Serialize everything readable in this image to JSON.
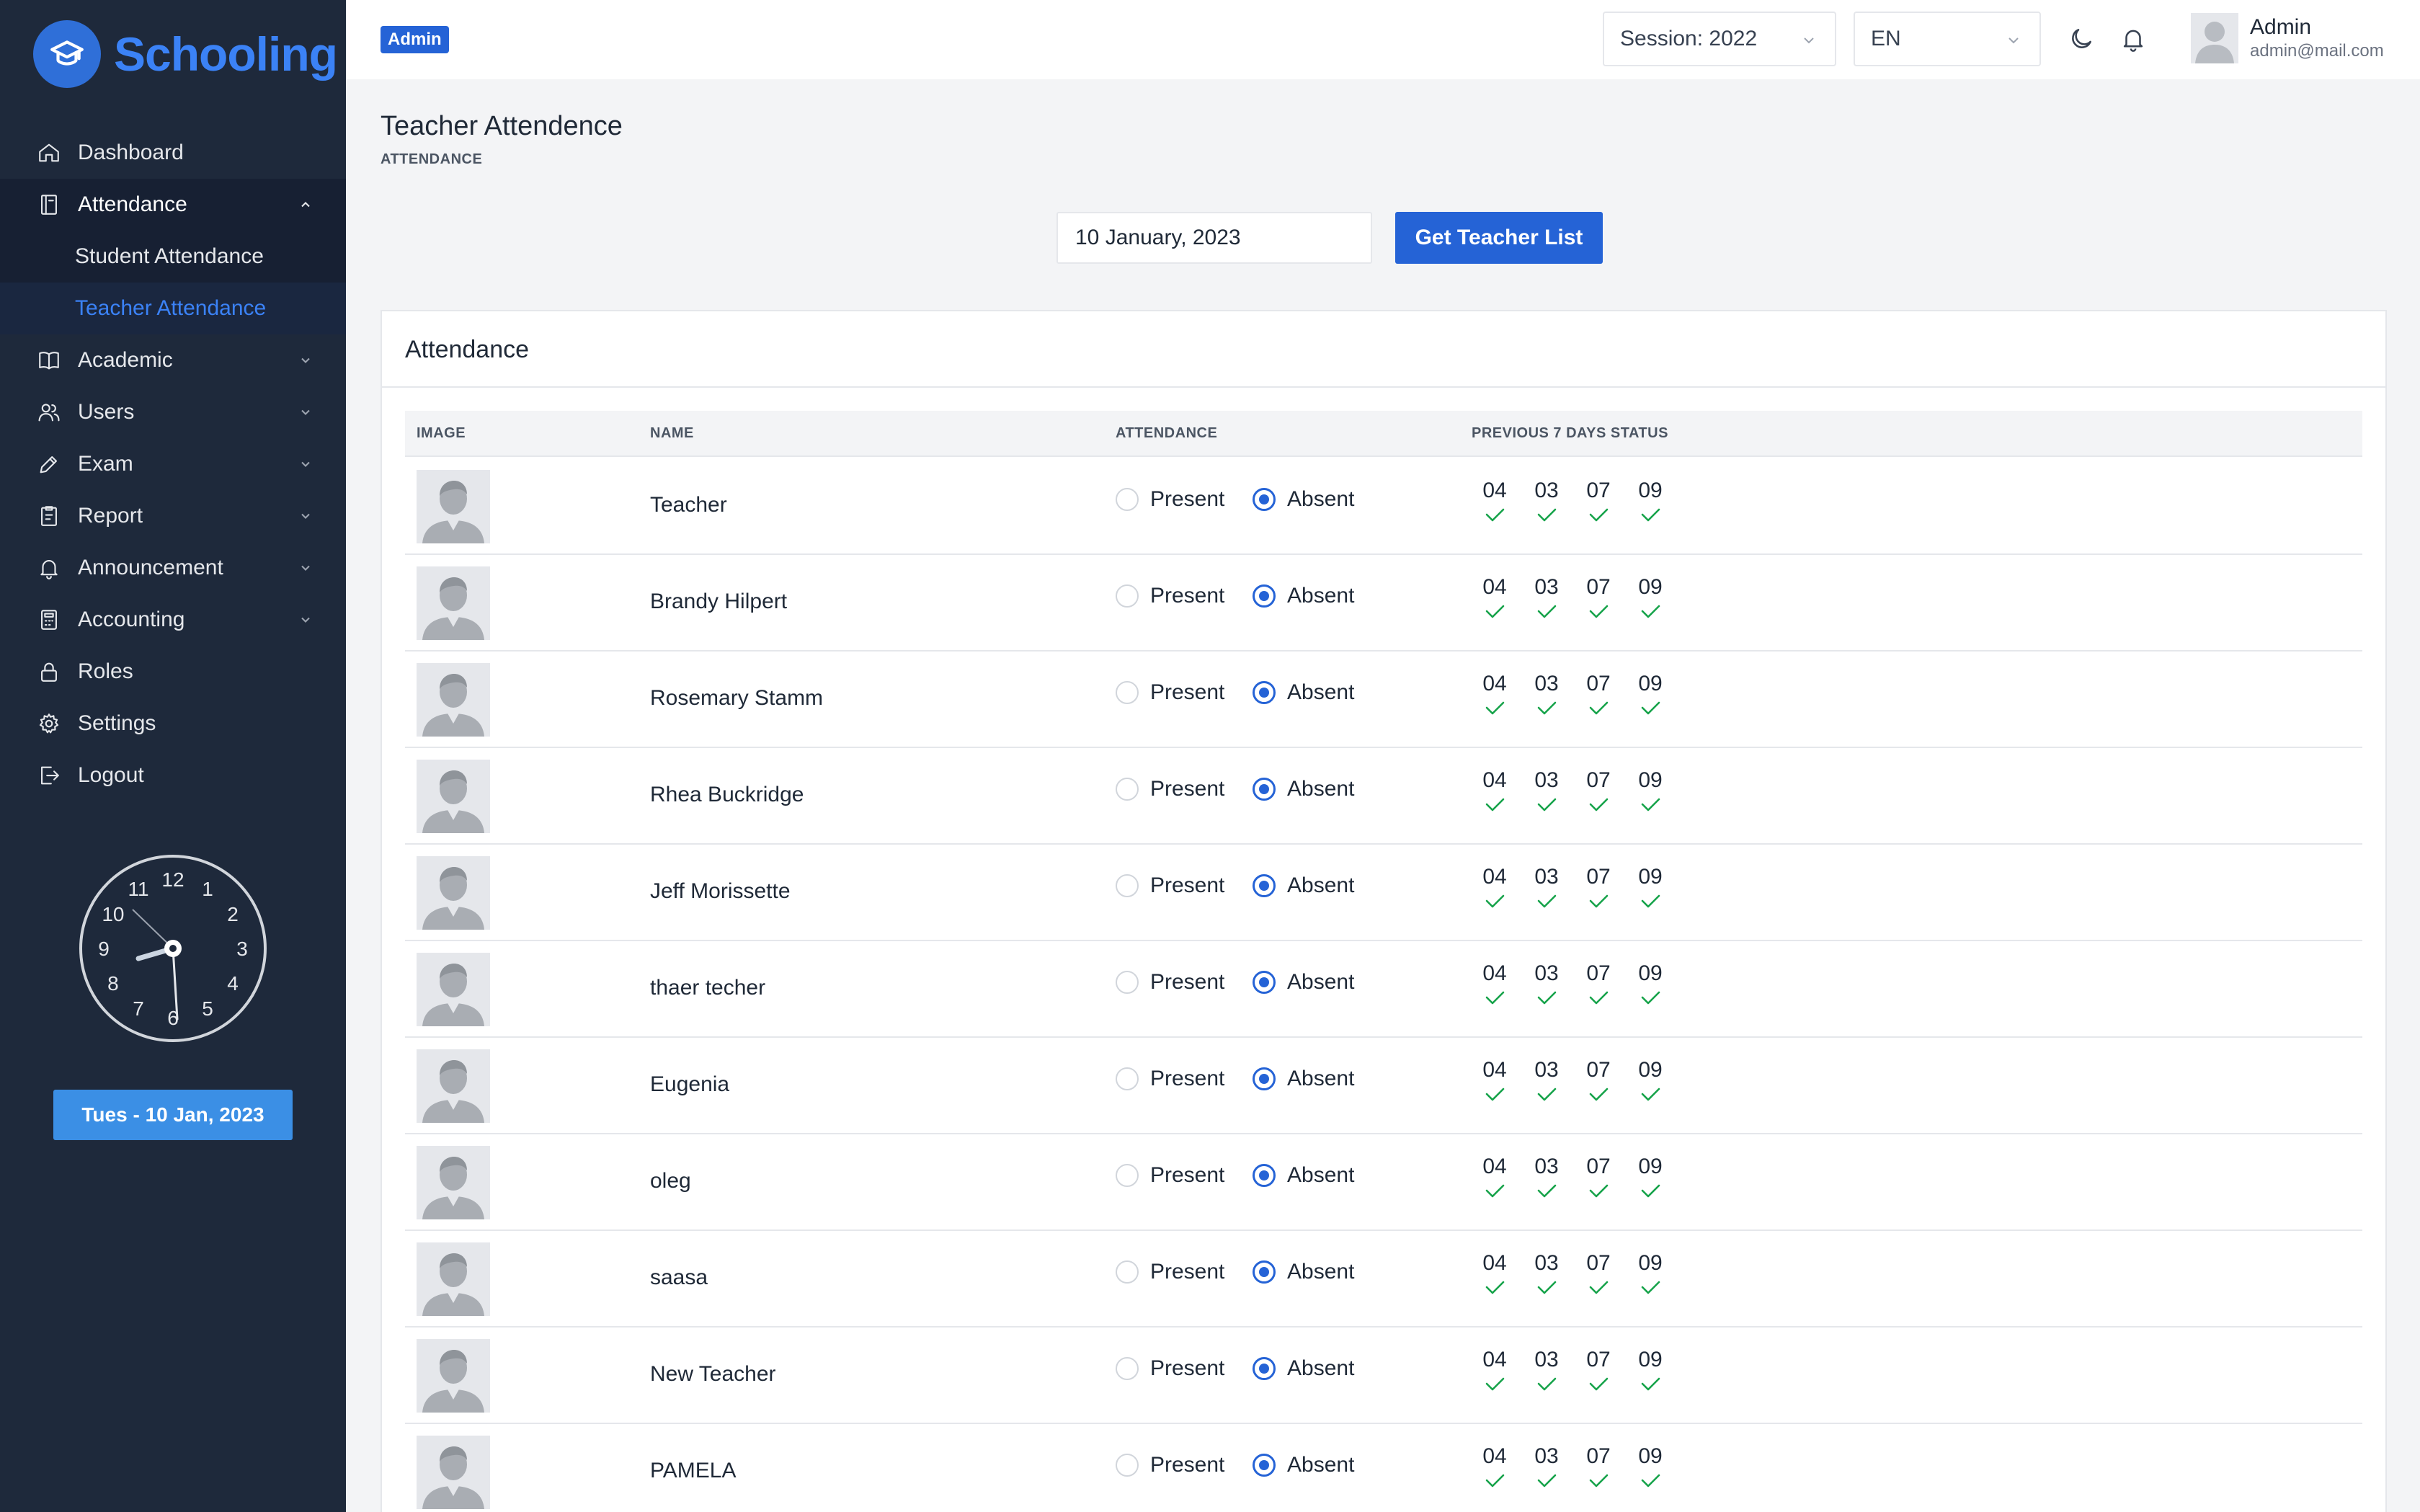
{
  "app": {
    "name": "Schooling",
    "role_badge": "Admin"
  },
  "sidebar": {
    "items": [
      {
        "label": "Dashboard",
        "icon": "home-icon",
        "has_children": false
      },
      {
        "label": "Attendance",
        "icon": "attendance-icon",
        "has_children": true,
        "expanded": true,
        "children": [
          {
            "label": "Student Attendance",
            "active": false
          },
          {
            "label": "Teacher Attendance",
            "active": true
          }
        ]
      },
      {
        "label": "Academic",
        "icon": "book-icon",
        "has_children": true
      },
      {
        "label": "Users",
        "icon": "users-icon",
        "has_children": true
      },
      {
        "label": "Exam",
        "icon": "pen-icon",
        "has_children": true
      },
      {
        "label": "Report",
        "icon": "report-icon",
        "has_children": true
      },
      {
        "label": "Announcement",
        "icon": "bell-icon",
        "has_children": true
      },
      {
        "label": "Accounting",
        "icon": "calculator-icon",
        "has_children": true
      },
      {
        "label": "Roles",
        "icon": "lock-icon",
        "has_children": false
      },
      {
        "label": "Settings",
        "icon": "gear-icon",
        "has_children": false
      },
      {
        "label": "Logout",
        "icon": "logout-icon",
        "has_children": false
      }
    ],
    "clock_numbers": [
      "12",
      "1",
      "2",
      "3",
      "4",
      "5",
      "6",
      "7",
      "8",
      "9",
      "10",
      "11"
    ],
    "date_label": "Tues - 10 Jan, 2023"
  },
  "header": {
    "session": "Session: 2022",
    "language": "EN",
    "user_name": "Admin",
    "user_email": "admin@mail.com"
  },
  "page": {
    "title": "Teacher Attendence",
    "subtitle": "ATTENDANCE",
    "date_value": "10 January, 2023",
    "get_button": "Get Teacher List"
  },
  "card": {
    "title": "Attendance",
    "columns": {
      "image": "IMAGE",
      "name": "NAME",
      "attendance": "ATTENDANCE",
      "previous": "PREVIOUS 7 DAYS STATUS"
    },
    "present_label": "Present",
    "absent_label": "Absent",
    "rows": [
      {
        "name": "Teacher",
        "status": "Absent",
        "days": [
          "04",
          "03",
          "07",
          "09"
        ]
      },
      {
        "name": "Brandy Hilpert",
        "status": "Absent",
        "days": [
          "04",
          "03",
          "07",
          "09"
        ]
      },
      {
        "name": "Rosemary Stamm",
        "status": "Absent",
        "days": [
          "04",
          "03",
          "07",
          "09"
        ]
      },
      {
        "name": "Rhea Buckridge",
        "status": "Absent",
        "days": [
          "04",
          "03",
          "07",
          "09"
        ]
      },
      {
        "name": "Jeff Morissette",
        "status": "Absent",
        "days": [
          "04",
          "03",
          "07",
          "09"
        ]
      },
      {
        "name": "thaer techer",
        "status": "Absent",
        "days": [
          "04",
          "03",
          "07",
          "09"
        ]
      },
      {
        "name": "Eugenia",
        "status": "Absent",
        "days": [
          "04",
          "03",
          "07",
          "09"
        ]
      },
      {
        "name": "oleg",
        "status": "Absent",
        "days": [
          "04",
          "03",
          "07",
          "09"
        ]
      },
      {
        "name": "saasa",
        "status": "Absent",
        "days": [
          "04",
          "03",
          "07",
          "09"
        ]
      },
      {
        "name": "New Teacher",
        "status": "Absent",
        "days": [
          "04",
          "03",
          "07",
          "09"
        ]
      },
      {
        "name": "PAMELA",
        "status": "Absent",
        "days": [
          "04",
          "03",
          "07",
          "09"
        ]
      }
    ]
  },
  "colors": {
    "accent": "#2563d6",
    "sidebar_bg": "#1e293b",
    "check": "#16a34a"
  }
}
